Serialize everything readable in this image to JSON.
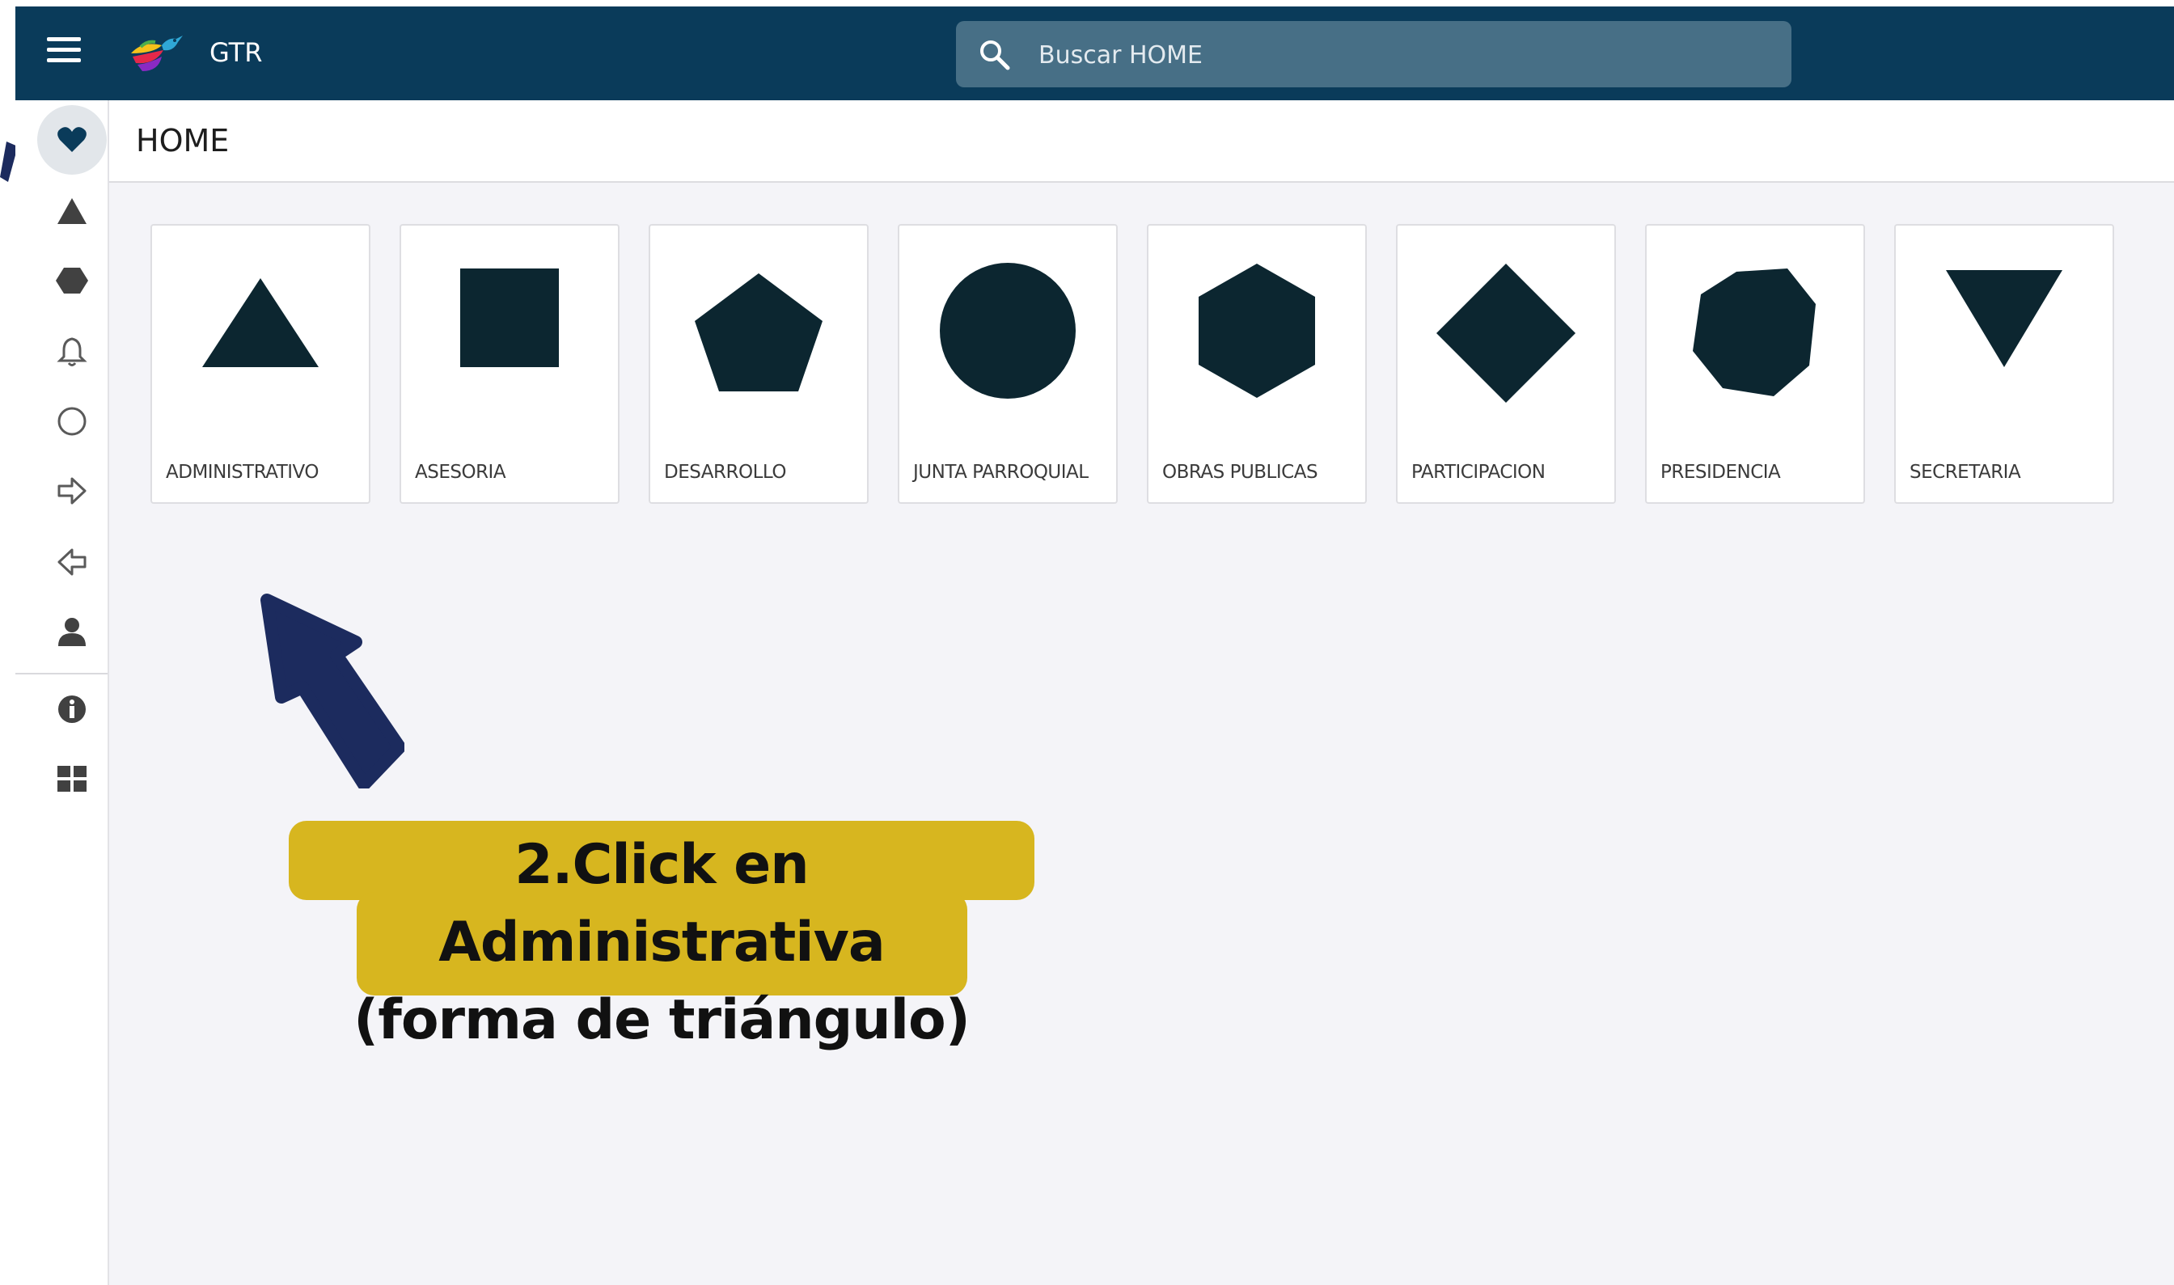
{
  "topbar": {
    "app_title": "GTR",
    "search_placeholder": "Buscar HOME",
    "bar_color": "#0a3b5a"
  },
  "sidebar": {
    "items": [
      {
        "icon": "heart-icon",
        "active": true
      },
      {
        "icon": "triangle-icon"
      },
      {
        "icon": "hexagon-icon"
      },
      {
        "icon": "bell-icon"
      },
      {
        "icon": "circle-icon"
      },
      {
        "icon": "arrow-right-icon"
      },
      {
        "icon": "arrow-left-icon"
      },
      {
        "icon": "user-icon"
      },
      {
        "icon": "info-icon"
      },
      {
        "icon": "dashboard-icon"
      }
    ]
  },
  "page": {
    "title": "HOME"
  },
  "cards": [
    {
      "label": "ADMINISTRATIVO",
      "icon": "triangle-icon"
    },
    {
      "label": "ASESORIA",
      "icon": "square-icon"
    },
    {
      "label": "DESARROLLO",
      "icon": "pentagon-icon"
    },
    {
      "label": "JUNTA PARROQUIAL",
      "icon": "circle-icon"
    },
    {
      "label": "OBRAS PUBLICAS",
      "icon": "hexagon-icon"
    },
    {
      "label": "PARTICIPACION",
      "icon": "diamond-icon"
    },
    {
      "label": "PRESIDENCIA",
      "icon": "octagon-icon"
    },
    {
      "label": "SECRETARIA",
      "icon": "inverted-triangle-icon"
    }
  ],
  "annotation": {
    "line1": "2.Click en Administrativa",
    "line2": "(forma de triángulo)",
    "highlight_color": "#d7b61f",
    "arrow_color": "#1c2b5e"
  },
  "colors": {
    "icon_dark": "#0c2630",
    "content_bg": "#f4f4f8"
  }
}
